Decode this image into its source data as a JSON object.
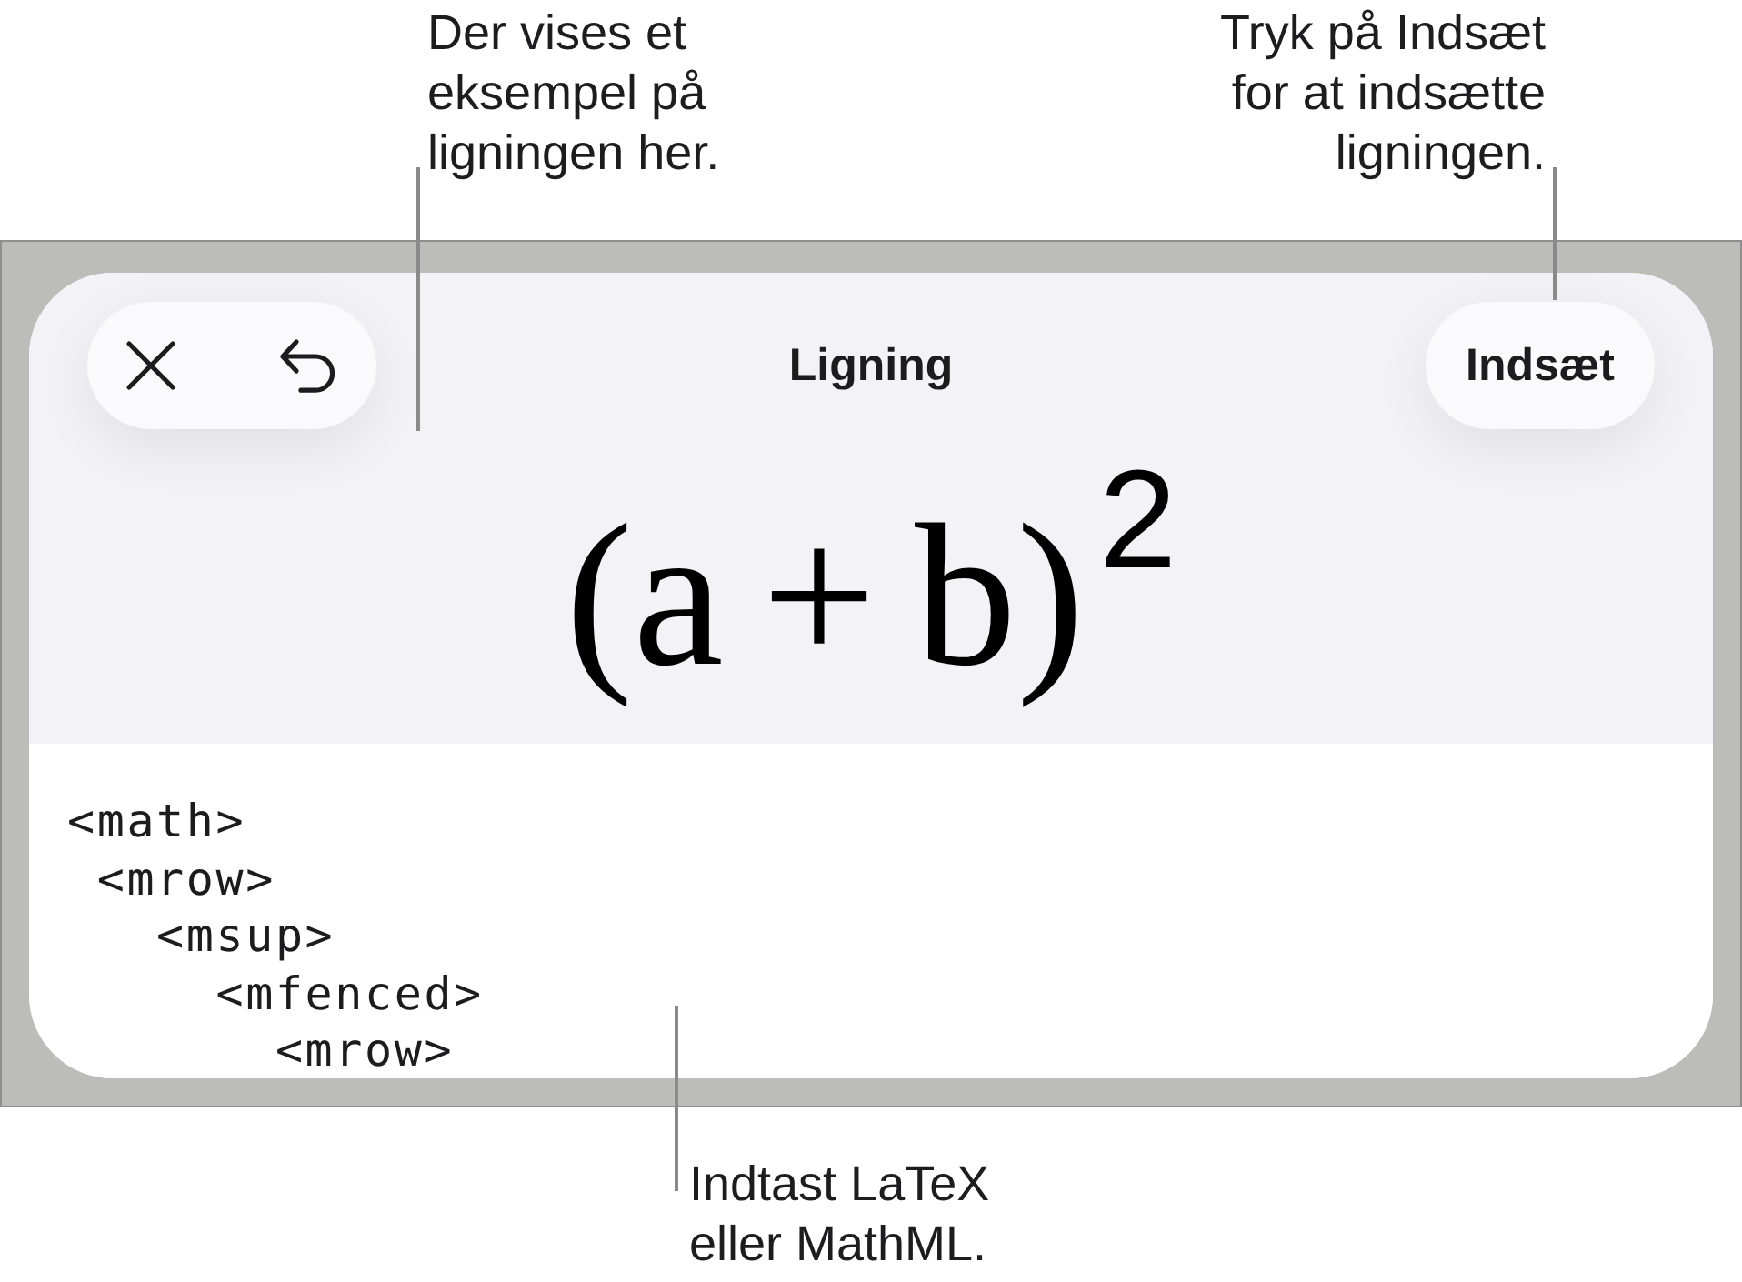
{
  "top_callouts": [
    {
      "text": "Der vises et eksempel på ligningen her."
    },
    {
      "text": "Tryk på Indsæt for at indsætte ligningen."
    }
  ],
  "equation_sheet": {
    "title": "Ligning",
    "insert_button": {
      "label": "Indsæt"
    },
    "preview": {
      "formula": "(a + b)$^{2}$"
    },
    "editor": {
      "lines": [
        {
          "text": "<math>",
          "children": [
            {
              "text": "<mrow>",
              "children": [
                {
                  "text": "<msup>",
                  "children": [
                    {
                      "text": "<mfenced>",
                      "children": [
                        {
                          "text": "<mrow>"
                        }
                      ]
                    }
                  ]
                }
              ]
            }
          ]
        }
      ]
    }
  },
  "bottom_callout": {
    "text": "Indtast LaTeX eller MathML."
  }
}
